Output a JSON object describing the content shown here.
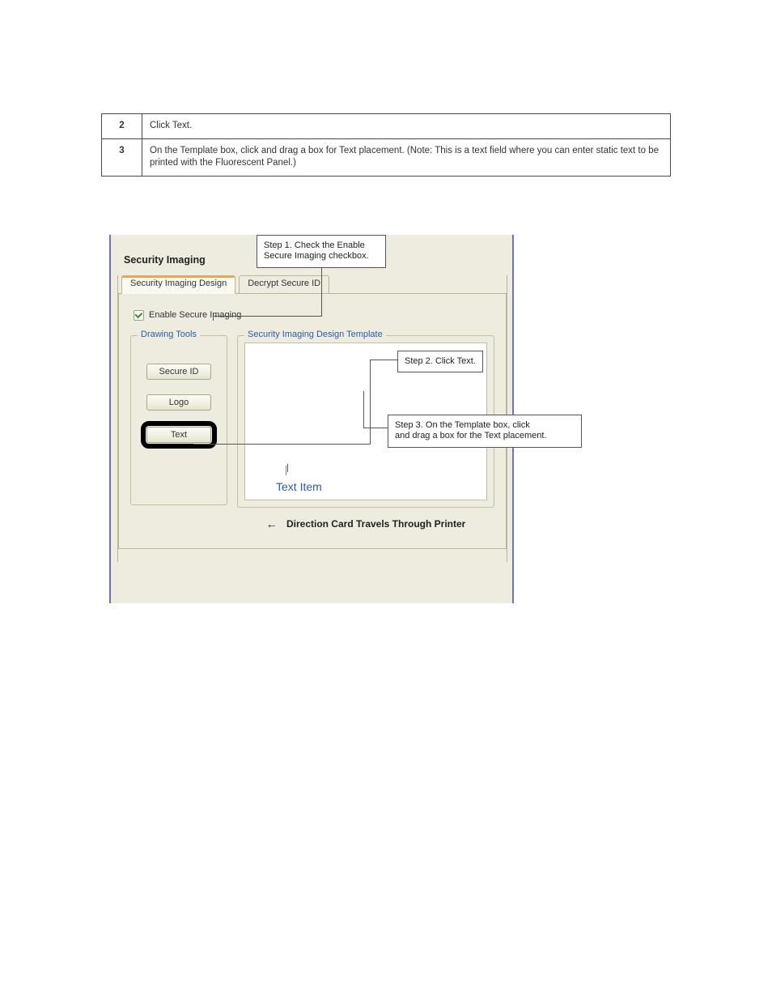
{
  "instructions": {
    "step2_num": "2",
    "step2_text": "Click Text.",
    "step3_num": "3",
    "step3_text": "On the Template box, click and drag a box for Text placement. (Note: This is a text field where you can enter static text to be printed with the Fluorescent Panel.)"
  },
  "mock": {
    "title": "Security Imaging",
    "tab_active": "Security Imaging Design",
    "tab_inactive": "Decrypt Secure ID",
    "enable_checkbox_label": "Enable Secure Imaging",
    "drawing_tools": {
      "legend": "Drawing Tools",
      "btn_secure_id": "Secure ID",
      "btn_logo": "Logo",
      "btn_text": "Text"
    },
    "template": {
      "legend": "Security Imaging Design Template",
      "sample_text": "Text Item"
    },
    "direction_text": "Direction Card Travels Through Printer"
  },
  "callouts": {
    "c1": "Step 1. Check the Enable\nSecure Imaging checkbox.",
    "c2": "Step 2. Click Text.",
    "c3": "Step 3. On the Template box, click\nand drag a box for the Text placement."
  }
}
